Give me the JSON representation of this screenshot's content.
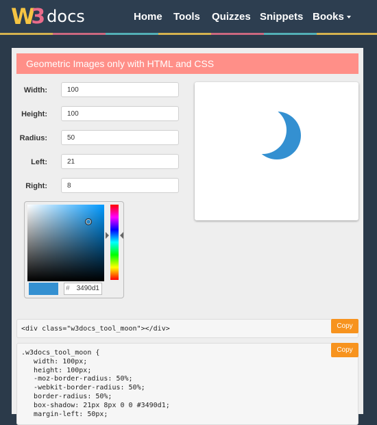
{
  "nav": {
    "logo_w": "W",
    "logo_3": "3",
    "logo_docs": "docs",
    "items": [
      "Home",
      "Tools",
      "Quizzes",
      "Snippets",
      "Books"
    ]
  },
  "banner": {
    "title": "Geometric Images only with HTML and CSS"
  },
  "form": {
    "width_label": "Width:",
    "width_value": "100",
    "height_label": "Height:",
    "height_value": "100",
    "radius_label": "Radius:",
    "radius_value": "50",
    "left_label": "Left:",
    "left_value": "21",
    "right_label": "Right:",
    "right_value": "8"
  },
  "picker": {
    "hash": "#",
    "hex": "3490d1",
    "color": "#3490d1"
  },
  "html_code": {
    "text": "<div class=\"w3docs_tool_moon\"></div>",
    "copy_label": "Copy"
  },
  "css_code": {
    "copy_label": "Copy",
    "lines": [
      ".w3docs_tool_moon {",
      "   width: 100px;",
      "   height: 100px;",
      "   -moz-border-radius: 50%;",
      "   -webkit-border-radius: 50%;",
      "   border-radius: 50%;",
      "   box-shadow: 21px 8px 0 0 #3490d1;",
      "   margin-left: 50px;"
    ]
  },
  "colors": {
    "accent": "#3490d1",
    "banner": "#ff8f88",
    "copy": "#f7931e",
    "nav": "#2d3e50"
  }
}
